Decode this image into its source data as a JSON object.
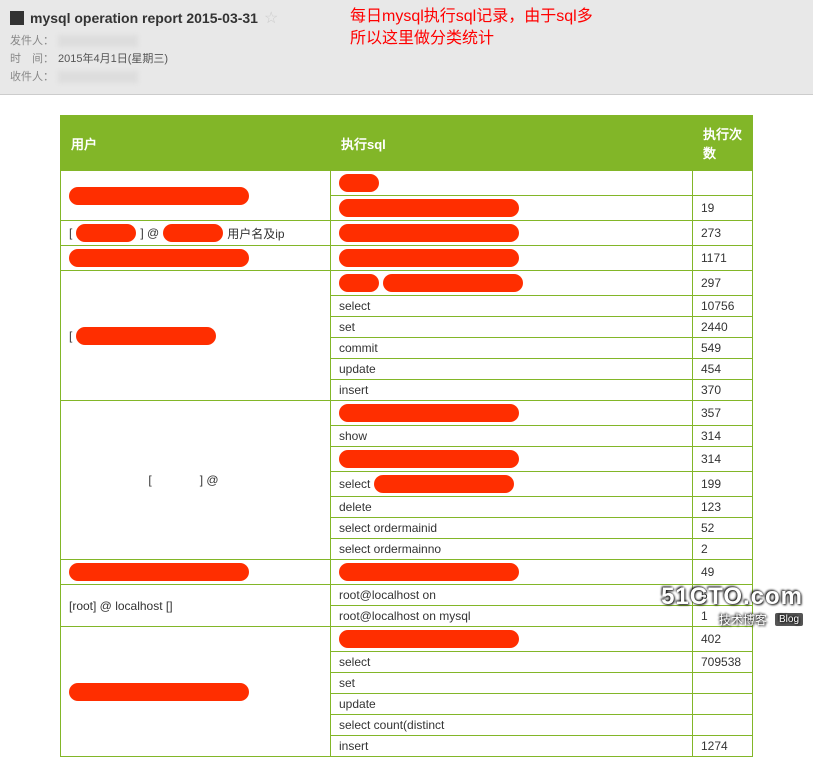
{
  "email": {
    "subject": "mysql operation report 2015-03-31",
    "from_label": "发件人：",
    "time_label": "时　间：",
    "time_value": "2015年4月1日(星期三)",
    "to_label": "收件人："
  },
  "annotation": {
    "line1": "每日mysql执行sql记录，由于sql多",
    "line2": "所以这里做分类统计"
  },
  "table": {
    "headers": {
      "user": "用户",
      "sql": "执行sql",
      "count": "执行次数"
    },
    "user_ip_label": "用户名及ip",
    "localhost_label": "[root] @ localhost []",
    "rows": [
      {
        "sql_redacted": true,
        "count": ""
      },
      {
        "sql_redacted": true,
        "count": "19"
      },
      {
        "sql_redacted": true,
        "count": "273"
      },
      {
        "sql_redacted": true,
        "count": "1171"
      },
      {
        "sql_redacted": true,
        "count": "297"
      },
      {
        "sql": "select",
        "count": "10756"
      },
      {
        "sql": "set",
        "count": "2440"
      },
      {
        "sql": "commit",
        "count": "549"
      },
      {
        "sql": "update",
        "count": "454"
      },
      {
        "sql": "insert",
        "count": "370"
      },
      {
        "sql_redacted": true,
        "count": "357"
      },
      {
        "sql": "show",
        "count": "314"
      },
      {
        "sql_redacted": true,
        "count": "314"
      },
      {
        "sql": "select",
        "sql_redact_suffix": true,
        "count": "199"
      },
      {
        "sql": "delete",
        "count": "123"
      },
      {
        "sql": "select ordermainid",
        "count": "52"
      },
      {
        "sql": "select ordermainno",
        "count": "2"
      },
      {
        "sql_redacted": true,
        "count": "49"
      },
      {
        "sql": "root@localhost on",
        "count": "5"
      },
      {
        "sql": "root@localhost on mysql",
        "count": "1"
      },
      {
        "sql_redacted": true,
        "count": "402"
      },
      {
        "sql": "select",
        "count": "709538"
      },
      {
        "sql": "set",
        "count": ""
      },
      {
        "sql": "update",
        "count": ""
      },
      {
        "sql": "select count(distinct",
        "count": ""
      },
      {
        "sql": "insert",
        "count": "1274"
      }
    ]
  },
  "watermark": {
    "main": "51CTO.com",
    "sub": "技术博客",
    "blog": "Blog"
  }
}
